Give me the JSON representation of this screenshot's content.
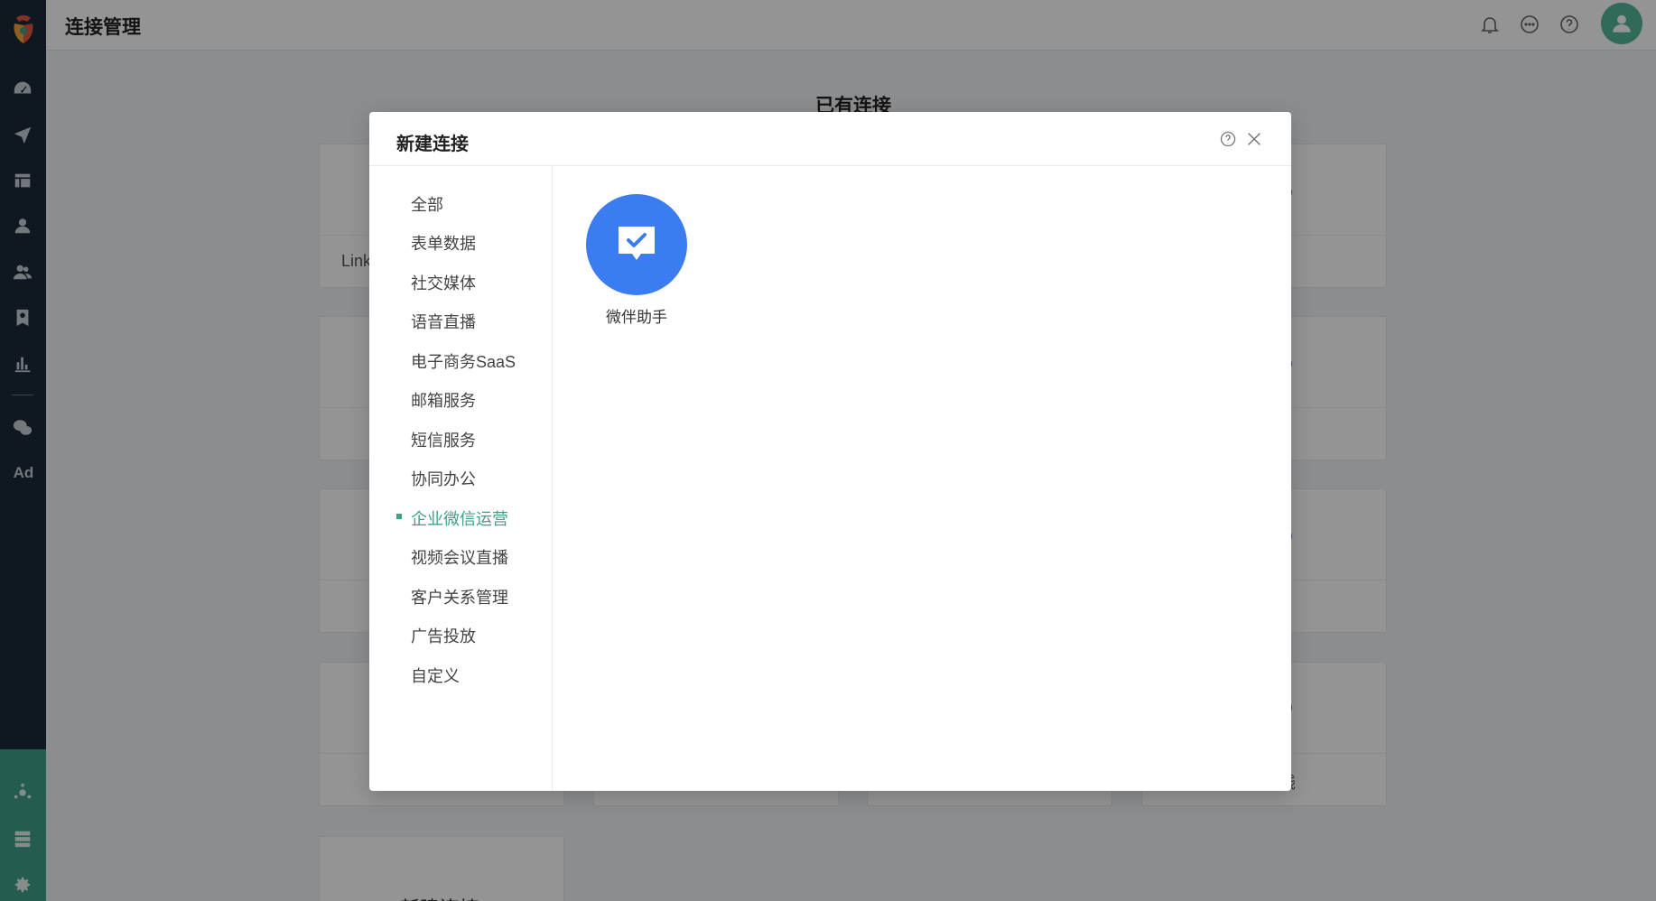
{
  "header": {
    "title": "连接管理"
  },
  "page": {
    "section_title": "已有连接",
    "card_partial_text": "Link",
    "card_partial_text_2": "钱",
    "new_connection_label": "+  新建连接"
  },
  "rail": {
    "ad_label": "Ad",
    "icons": [
      "dashboard-icon",
      "send-icon",
      "layout-icon",
      "user-icon",
      "users-icon",
      "badge-icon",
      "bar-chart-icon",
      "wechat-icon",
      "ad-icon",
      "connection-icon",
      "server-icon",
      "settings-icon"
    ]
  },
  "modal": {
    "title": "新建连接",
    "categories": [
      {
        "label": "全部"
      },
      {
        "label": "表单数据"
      },
      {
        "label": "社交媒体"
      },
      {
        "label": "语音直播"
      },
      {
        "label": "电子商务SaaS"
      },
      {
        "label": "邮箱服务"
      },
      {
        "label": "短信服务"
      },
      {
        "label": "协同办公"
      },
      {
        "label": "企业微信运营"
      },
      {
        "label": "视频会议直播"
      },
      {
        "label": "客户关系管理"
      },
      {
        "label": "广告投放"
      },
      {
        "label": "自定义"
      }
    ],
    "active_category": "企业微信运营",
    "apps": [
      {
        "label": "微伴助手",
        "icon": "chat-check-icon"
      }
    ]
  },
  "colors": {
    "accent": "#3fa18a",
    "app_blue": "#3b7cf0",
    "rail_bg": "#1b2a3a"
  }
}
